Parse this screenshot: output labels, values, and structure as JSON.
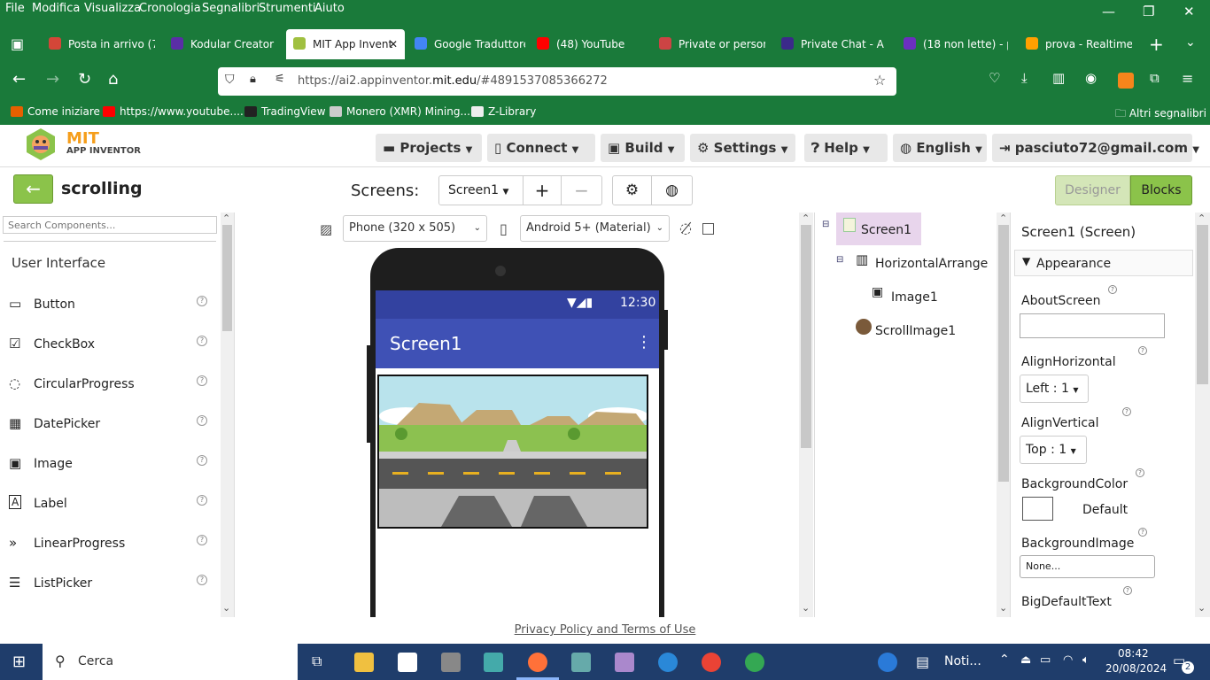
{
  "menubar": {
    "items": [
      "File",
      "Modifica",
      "Visualizza",
      "Cronologia",
      "Segnalibri",
      "Strumenti",
      "Aiuto"
    ]
  },
  "tabs": [
    {
      "label": "Posta in arrivo (76",
      "color": "#d44638"
    },
    {
      "label": "Kodular Creator",
      "color": "#5a2ea6"
    },
    {
      "label": "MIT App Invent",
      "color": "#a0c040"
    },
    {
      "label": "Google Traduttore",
      "color": "#4285f4"
    },
    {
      "label": "(48) YouTube",
      "color": "#ff0000"
    },
    {
      "label": "Private or persona",
      "color": "#cc4444"
    },
    {
      "label": "Private Chat - A p",
      "color": "#3b2a8a"
    },
    {
      "label": "(18 non lette) - pa",
      "color": "#6b2fbf"
    },
    {
      "label": "prova - Realtime D",
      "color": "#ffa000"
    }
  ],
  "url": {
    "prefix": "https://ai2.appinventor.",
    "domain": "mit.edu",
    "suffix": "/#4891537085366272"
  },
  "bookmarks": [
    "Come iniziare",
    "https://www.youtube....",
    "TradingView",
    "Monero (XMR) Mining...",
    "Z-Library"
  ],
  "bookmarks_other": "Altri segnalibri",
  "logo": {
    "title": "MIT",
    "subtitle": "APP INVENTOR"
  },
  "topmenu": {
    "projects": "Projects",
    "connect": "Connect",
    "build": "Build",
    "settings": "Settings",
    "help": "Help",
    "language": "English",
    "account": "pasciuto72@gmail.com"
  },
  "project": {
    "name": "scrolling",
    "screens_label": "Screens:",
    "screen": "Screen1",
    "add": "+",
    "remove": "−"
  },
  "mode": {
    "designer": "Designer",
    "blocks": "Blocks"
  },
  "palette": {
    "search_placeholder": "Search Components...",
    "category": "User Interface",
    "items": [
      {
        "label": "Button",
        "icon": "▭"
      },
      {
        "label": "CheckBox",
        "icon": "☑"
      },
      {
        "label": "CircularProgress",
        "icon": "◌"
      },
      {
        "label": "DatePicker",
        "icon": "▦"
      },
      {
        "label": "Image",
        "icon": "▣"
      },
      {
        "label": "Label",
        "icon": "A"
      },
      {
        "label": "LinearProgress",
        "icon": "»"
      },
      {
        "label": "ListPicker",
        "icon": "☰"
      }
    ]
  },
  "viewer": {
    "device": "Phone (320 x 505)",
    "theme": "Android 5+ (Material)",
    "time": "12:30",
    "screen_title": "Screen1"
  },
  "tree": {
    "screen": "Screen1",
    "arrangement": "HorizontalArrange",
    "image": "Image1",
    "scroll": "ScrollImage1"
  },
  "props": {
    "header": "Screen1 (Screen)",
    "section": "Appearance",
    "about": "AboutScreen",
    "alignh": "AlignHorizontal",
    "alignh_value": "Left : 1",
    "alignv": "AlignVertical",
    "alignv_value": "Top : 1",
    "bgcolor": "BackgroundColor",
    "bgcolor_value": "Default",
    "bgimage": "BackgroundImage",
    "bgimage_value": "None...",
    "bigtext": "BigDefaultText"
  },
  "footer": "Privacy Policy and Terms of Use",
  "taskbar": {
    "search": "Cerca",
    "notif": "Noti...",
    "time": "08:42",
    "date": "20/08/2024",
    "badge": "2"
  }
}
